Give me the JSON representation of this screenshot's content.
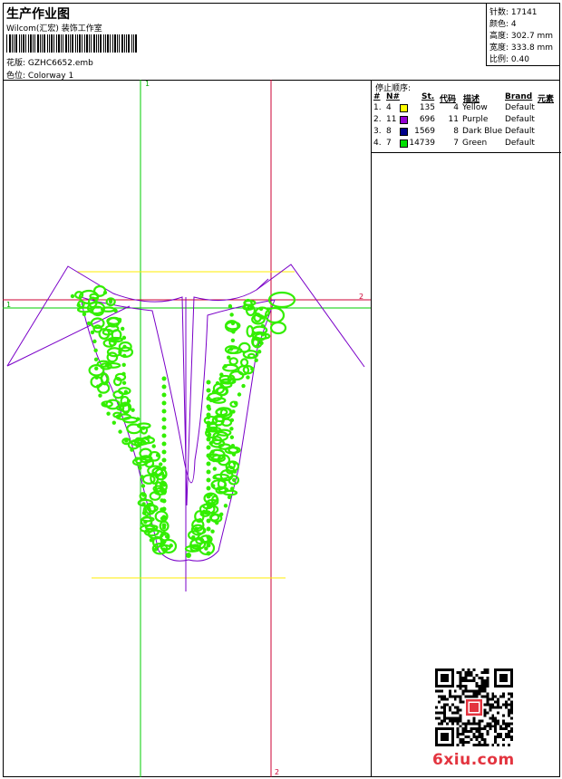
{
  "header": {
    "title": "生产作业图",
    "company": "Wilcom(汇宏) 装饰工作室",
    "design_label": "花版: ",
    "design_value": "GZHC6652.emb",
    "colorway_label": "色位: ",
    "colorway_value": "Colorway 1"
  },
  "stats": {
    "stitches_label": "针数: ",
    "stitches": "17141",
    "colors_label": "颜色: ",
    "colors": "4",
    "height_label": "高度: ",
    "height": "302.7 mm",
    "width_label": "宽度: ",
    "width": "333.8 mm",
    "scale_label": "比例: ",
    "scale": "0.40"
  },
  "stop_sequence": {
    "heading": "停止顺序:",
    "columns": [
      "#",
      "N#",
      "St.",
      "代码",
      "描述",
      "Brand",
      "元素"
    ],
    "rows": [
      {
        "index": "1.",
        "needle": "4",
        "color": "#ffff00",
        "stitches": "135",
        "code": "4",
        "description": "Yellow",
        "brand": "Default"
      },
      {
        "index": "2.",
        "needle": "11",
        "color": "#9400d3",
        "stitches": "696",
        "code": "11",
        "description": "Purple",
        "brand": "Default"
      },
      {
        "index": "3.",
        "needle": "8",
        "color": "#00008b",
        "stitches": "1569",
        "code": "8",
        "description": "Dark Blue",
        "brand": "Default"
      },
      {
        "index": "4.",
        "needle": "7",
        "color": "#00e000",
        "stitches": "14739",
        "code": "7",
        "description": "Green",
        "brand": "Default"
      }
    ]
  },
  "guides": {
    "vertical_1": "1",
    "vertical_2": "2",
    "horizontal_1": "1",
    "horizontal_2": "2"
  },
  "watermark": {
    "text": "6xiu.com",
    "seal_text": "汇宏"
  },
  "colors": {
    "guide_green": "#00cc00",
    "guide_red": "#cc0033",
    "guide_yellow": "#ffee00",
    "outline_purple": "#7a00c8",
    "stitch_green": "#33ee00"
  }
}
